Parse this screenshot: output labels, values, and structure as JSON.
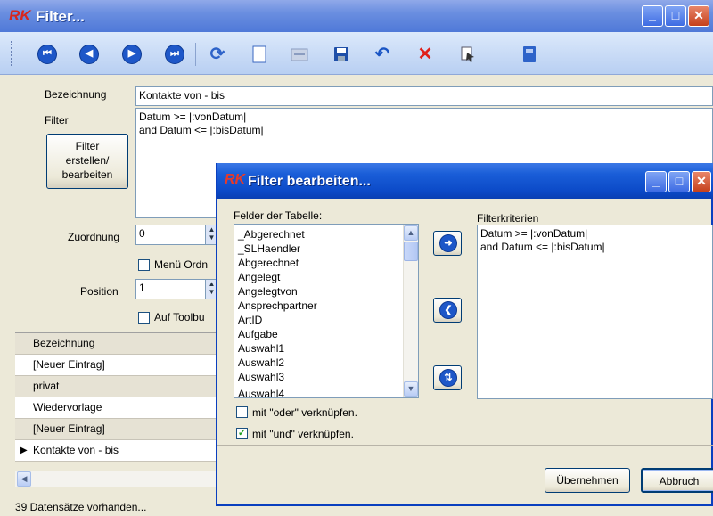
{
  "window": {
    "title": "Filter...",
    "app_icon": "RK",
    "icons": [
      "minimize-icon",
      "maximize-icon",
      "close-icon"
    ]
  },
  "toolbar": {
    "nav_first": "⏮",
    "nav_prev": "◀",
    "nav_next": "▶",
    "nav_last": "⏭",
    "buttons": [
      "first-record-icon",
      "previous-record-icon",
      "next-record-icon",
      "last-record-icon",
      "refresh-icon",
      "new-document-icon",
      "edit-icon",
      "save-icon",
      "undo-icon",
      "delete-icon",
      "copy-icon",
      "book-icon"
    ]
  },
  "form": {
    "bezeichnung_label": "Bezeichnung",
    "bezeichnung_value": "Kontakte von - bis",
    "filter_label": "Filter",
    "filter_value": "Datum >= |:vonDatum|\nand Datum <= |:bisDatum|",
    "filter_button": "Filter\nerstellen/\nbearbeiten",
    "zuordnung_label": "Zuordnung",
    "zuordnung_value": "0",
    "menu_checkbox_label": "Menü Ordn",
    "position_label": "Position",
    "position_value": "1",
    "toolbar_checkbox_label": "Auf Toolbu"
  },
  "grid": {
    "rows": [
      "Bezeichnung",
      "[Neuer Eintrag]",
      "privat",
      "Wiedervorlage",
      "[Neuer Eintrag]",
      "Kontakte von - bis"
    ],
    "current_row_marker": "▶"
  },
  "status": {
    "text": "39 Datensätze vorhanden..."
  },
  "dialog": {
    "title": "Filter bearbeiten...",
    "app_icon": "RK",
    "fields_label": "Felder der Tabelle:",
    "fields": [
      "_Abgerechnet",
      "_SLHaendler",
      "Abgerechnet",
      "Angelegt",
      "Angelegtvon",
      "Ansprechpartner",
      "ArtID",
      "Aufgabe",
      "Auswahl1",
      "Auswahl2",
      "Auswahl3",
      "Auswahl4"
    ],
    "criteria_label": "Filterkriterien",
    "criteria_value": "Datum >= |:vonDatum|\nand Datum <= |:bisDatum|",
    "or_label": "mit \"oder\" verknüpfen.",
    "and_label": "mit \"und\" verknüpfen.",
    "or_checked": false,
    "and_checked": true,
    "apply_button": "Übernehmen",
    "cancel_button": "Abbruch",
    "add_arrow": "➜",
    "remove_arrow": "❮",
    "swap_arrow": "⇅"
  }
}
